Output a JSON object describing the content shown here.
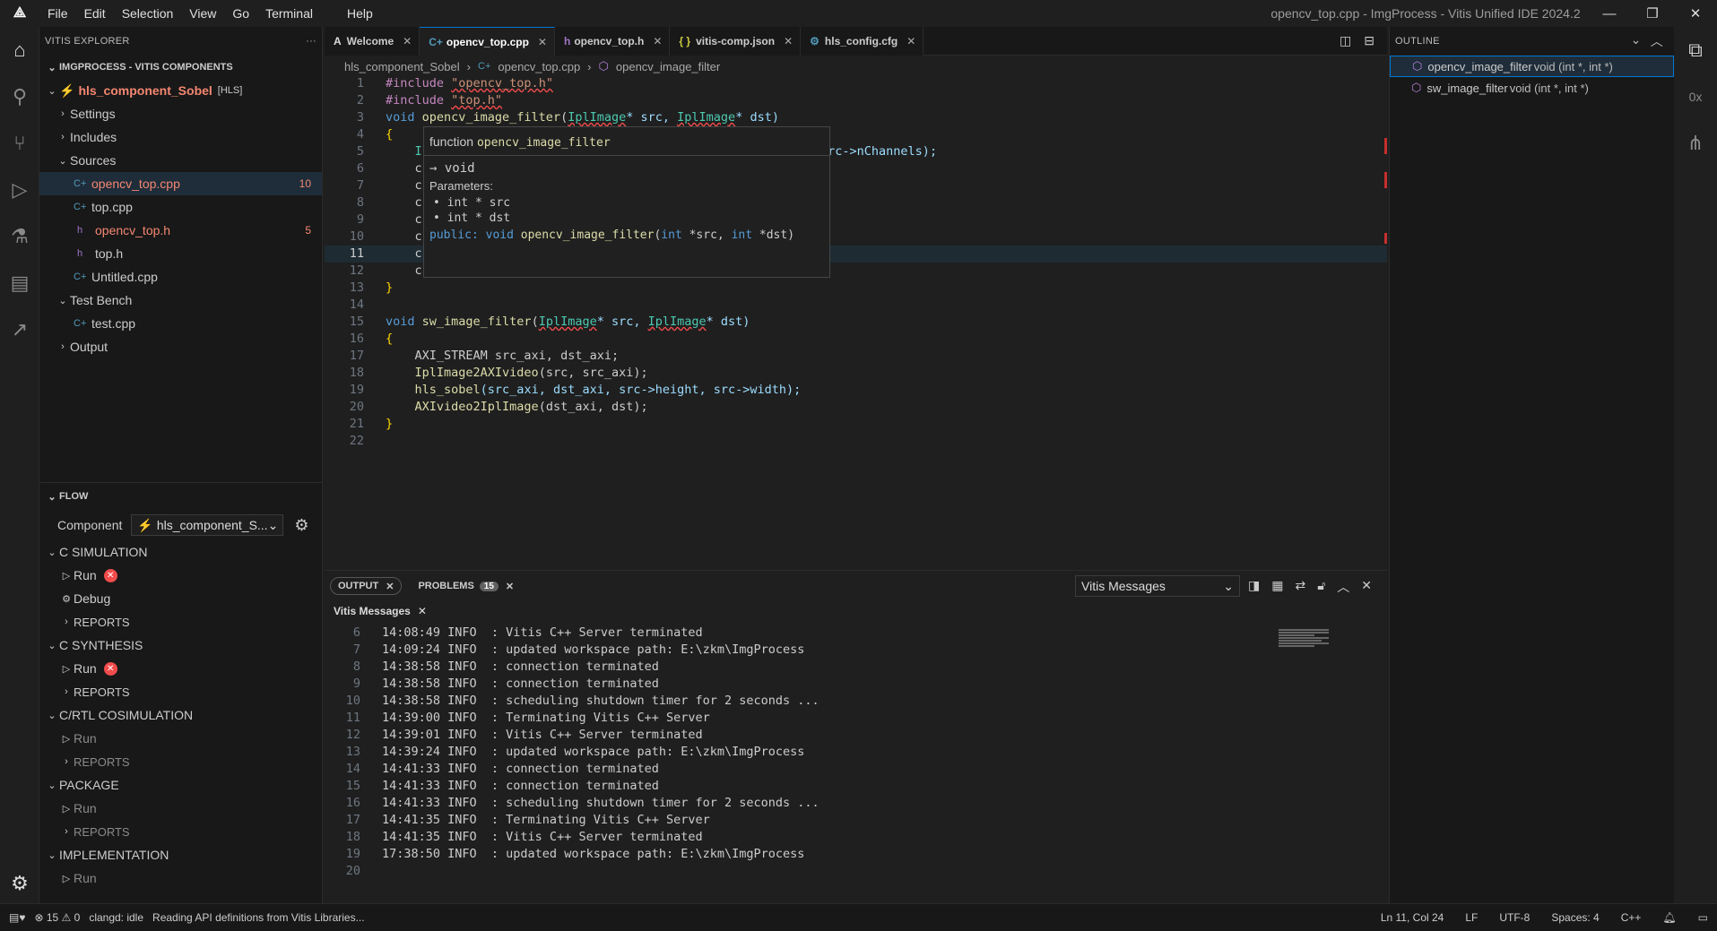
{
  "titlebar": {
    "menu": [
      "File",
      "Edit",
      "Selection",
      "View",
      "Go",
      "Terminal",
      "Help"
    ],
    "title": "opencv_top.cpp - ImgProcess - Vitis Unified IDE 2024.2",
    "minimize": "—",
    "restore": "❐",
    "close": "✕"
  },
  "explorer": {
    "header": "VITIS EXPLORER",
    "more": "···",
    "section": "IMGPROCESS - VITIS COMPONENTS",
    "component_name": "hls_component_Sobel",
    "component_tag": "[HLS]",
    "items": {
      "settings": "Settings",
      "includes": "Includes",
      "sources": "Sources",
      "f1": "opencv_top.cpp",
      "f1_badge": "10",
      "f2": "top.cpp",
      "f3": "opencv_top.h",
      "f3_badge": "5",
      "f4": "top.h",
      "f5": "Untitled.cpp",
      "testbench": "Test Bench",
      "f6": "test.cpp",
      "output": "Output"
    }
  },
  "flow": {
    "header": "FLOW",
    "component_label": "Component",
    "component_value": "hls_component_S...",
    "csim": "C SIMULATION",
    "run": "Run",
    "debug": "Debug",
    "reports": "REPORTS",
    "csynth": "C SYNTHESIS",
    "cosim": "C/RTL COSIMULATION",
    "package": "PACKAGE",
    "impl": "IMPLEMENTATION"
  },
  "tabs": [
    {
      "label": "Welcome",
      "icon": "A"
    },
    {
      "label": "opencv_top.cpp",
      "icon": "C+"
    },
    {
      "label": "opencv_top.h",
      "icon": "h"
    },
    {
      "label": "vitis-comp.json",
      "icon": "{ }"
    },
    {
      "label": "hls_config.cfg",
      "icon": "⚙"
    }
  ],
  "breadcrumb": {
    "a": "hls_component_Sobel",
    "b": "opencv_top.cpp",
    "c": "opencv_image_filter"
  },
  "editor": {
    "line_numbers": [
      "1",
      "2",
      "3",
      "4",
      "5",
      "6",
      "7",
      "8",
      "9",
      "10",
      "11",
      "12",
      "13",
      "14",
      "15",
      "16",
      "17",
      "18",
      "19",
      "20",
      "21",
      "22"
    ],
    "l1_pp": "#include ",
    "l1_str": "\"opencv_top.h\"",
    "l2_pp": "#include ",
    "l2_str": "\"top.h\"",
    "l3_kw": "void ",
    "l3_fn": "opencv_image_filter",
    "l3_p1": "(",
    "l3_t1": "IplImage",
    "l3_v1": "* src, ",
    "l3_t2": "IplImage",
    "l3_v2": "* dst)",
    "l4": "{",
    "l5_a": "    I",
    "l5_b": "h, src->nChannels);",
    "l6": "    c",
    "l7": "    c",
    "l8": "    c",
    "l9": "    c",
    "l10": "    c",
    "l11": "    c",
    "l12": "    c",
    "l13": "}",
    "l15_kw": "void ",
    "l15_fn": "sw_image_filter",
    "l15_p1": "(",
    "l15_t1": "IplImage",
    "l15_v1": "* src, ",
    "l15_t2": "IplImage",
    "l15_v2": "* dst)",
    "l16": "{",
    "l17": "    AXI_STREAM src_axi, dst_axi;",
    "l18_fn": "IplImage2AXIvideo",
    "l18_rest": "(src, src_axi);",
    "l19_fn": "hls_sobel",
    "l19_rest": "(src_axi, dst_axi, src->height, src->width);",
    "l20_fn": "AXIvideo2IplImage",
    "l20_rest": "(dst_axi, dst);",
    "l21": "}"
  },
  "hover": {
    "kind": "function",
    "name": "opencv_image_filter",
    "returns": "→ void",
    "params_label": "Parameters:",
    "p1": "int * src",
    "p2": "int * dst",
    "sig_prefix": "public: void ",
    "sig_fn": "opencv_image_filter",
    "sig_a": "(",
    "sig_int1": "int",
    "sig_b": " *src, ",
    "sig_int2": "int",
    "sig_c": " *dst)"
  },
  "panel": {
    "output_tab": "OUTPUT",
    "problems_tab": "PROBLEMS",
    "problems_count": "15",
    "channel": "Vitis Messages",
    "channel_tab": "Vitis Messages",
    "line_numbers": [
      "6",
      "7",
      "8",
      "9",
      "10",
      "11",
      "12",
      "13",
      "14",
      "15",
      "16",
      "17",
      "18",
      "19",
      "20"
    ],
    "lines": [
      "14:08:49 INFO  : Vitis C++ Server terminated",
      "14:09:24 INFO  : updated workspace path: E:\\zkm\\ImgProcess",
      "14:38:58 INFO  : connection terminated",
      "14:38:58 INFO  : connection terminated",
      "14:38:58 INFO  : scheduling shutdown timer for 2 seconds ...",
      "14:39:00 INFO  : Terminating Vitis C++ Server",
      "14:39:01 INFO  : Vitis C++ Server terminated",
      "14:39:24 INFO  : updated workspace path: E:\\zkm\\ImgProcess",
      "14:41:33 INFO  : connection terminated",
      "14:41:33 INFO  : connection terminated",
      "14:41:33 INFO  : scheduling shutdown timer for 2 seconds ...",
      "14:41:35 INFO  : Terminating Vitis C++ Server",
      "14:41:35 INFO  : Vitis C++ Server terminated",
      "17:38:50 INFO  : updated workspace path: E:\\zkm\\ImgProcess",
      ""
    ]
  },
  "outline": {
    "header": "OUTLINE",
    "items": [
      {
        "name": "opencv_image_filter",
        "sig": "void (int *, int *)"
      },
      {
        "name": "sw_image_filter",
        "sig": "void (int *, int *)"
      }
    ]
  },
  "statusbar": {
    "problems": "⊗ 15 ⚠ 0",
    "clangd": "clangd: idle",
    "message": "Reading API definitions from Vitis Libraries...",
    "position": "Ln 11, Col 24",
    "eol": "LF",
    "encoding": "UTF-8",
    "spaces": "Spaces: 4",
    "lang": "C++"
  },
  "colors": {
    "accent": "#0078d4",
    "error": "#f14c4c",
    "warning_text": "#f48771"
  }
}
